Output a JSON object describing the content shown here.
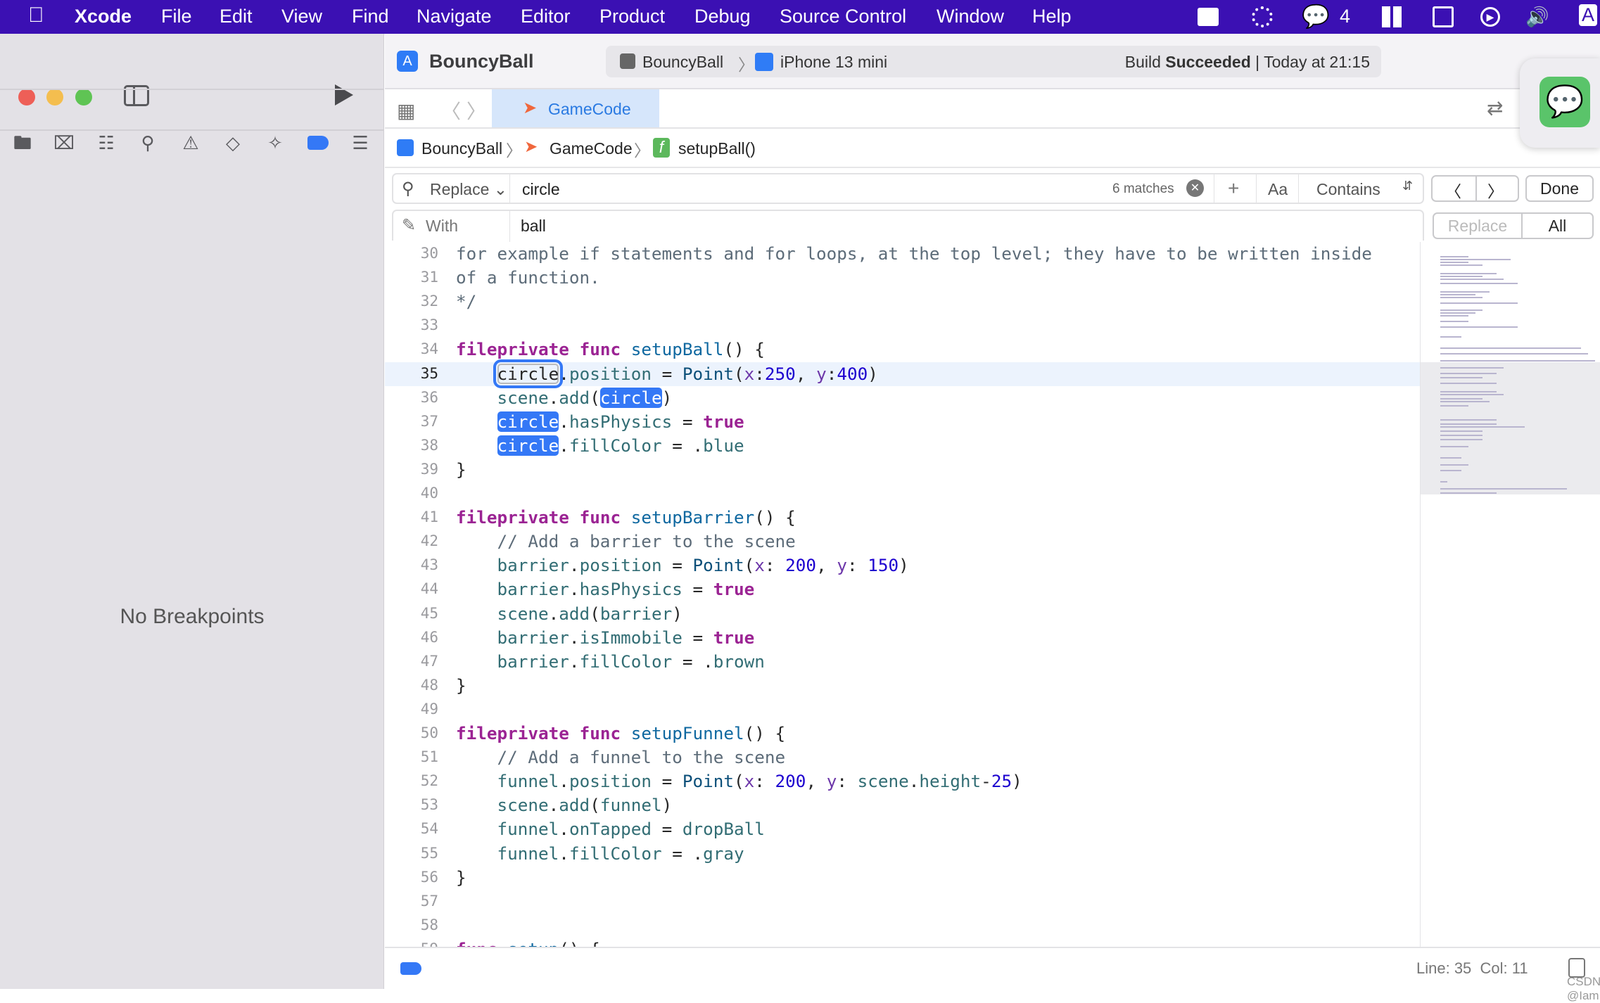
{
  "menubar": {
    "app": "Xcode",
    "items": [
      "File",
      "Edit",
      "View",
      "Find",
      "Navigate",
      "Editor",
      "Product",
      "Debug",
      "Source Control",
      "Window",
      "Help"
    ],
    "wechat_count": "4",
    "input_badge": "A"
  },
  "window": {
    "project": "BouncyBall",
    "scheme": "BouncyBall",
    "device": "iPhone 13 mini",
    "build_prefix": "Build",
    "build_status": "Succeeded",
    "build_time": "Today at 21:15"
  },
  "sidebar": {
    "empty_text": "No Breakpoints"
  },
  "tabs": [
    {
      "label": "GameCode",
      "active": true
    }
  ],
  "breadcrumb": [
    "BouncyBall",
    "GameCode",
    "setupBall()"
  ],
  "find": {
    "mode": "Replace",
    "query": "circle",
    "matches": "6 matches",
    "case_label": "Aa",
    "match_type": "Contains",
    "done": "Done",
    "with_label": "With",
    "replacement": "ball",
    "replace_label": "Replace",
    "all_label": "All"
  },
  "status": {
    "position": "Line: 35  Col: 11",
    "watermark": "CSDN @IamKieran"
  },
  "colors": {
    "accent": "#3478f6",
    "menubar": "#3b10b3",
    "keyword": "#9b2393"
  },
  "editor": {
    "current_line": 35,
    "lines": [
      {
        "n": 30,
        "t": [
          [
            "for example if statements and for loops, at the top level; they have to be written inside",
            "c"
          ]
        ]
      },
      {
        "n": 31,
        "t": [
          [
            "of a function.",
            "c"
          ]
        ]
      },
      {
        "n": 32,
        "t": [
          [
            "*/",
            "c"
          ]
        ]
      },
      {
        "n": 33,
        "t": []
      },
      {
        "n": 34,
        "t": [
          [
            "fileprivate",
            "k"
          ],
          [
            " "
          ],
          [
            "func",
            "k"
          ],
          [
            " "
          ],
          [
            "setupBall",
            "f"
          ],
          [
            "() {"
          ]
        ]
      },
      {
        "n": 35,
        "t": [
          [
            "    "
          ],
          [
            "circle",
            "mc"
          ],
          [
            "."
          ],
          [
            "position",
            "p"
          ],
          [
            " = "
          ],
          [
            "Point",
            "t"
          ],
          [
            "("
          ],
          [
            "x",
            "l"
          ],
          [
            ":"
          ],
          [
            "250",
            "n"
          ],
          [
            ", "
          ],
          [
            "y",
            "l"
          ],
          [
            ":"
          ],
          [
            "400",
            "n"
          ],
          [
            ")"
          ]
        ]
      },
      {
        "n": 36,
        "t": [
          [
            "    "
          ],
          [
            "scene",
            "p"
          ],
          [
            "."
          ],
          [
            "add",
            "p"
          ],
          [
            "("
          ],
          [
            "circle",
            "m"
          ],
          [
            ")"
          ]
        ]
      },
      {
        "n": 37,
        "t": [
          [
            "    "
          ],
          [
            "circle",
            "m"
          ],
          [
            "."
          ],
          [
            "hasPhysics",
            "p"
          ],
          [
            " = "
          ],
          [
            "true",
            "k"
          ]
        ]
      },
      {
        "n": 38,
        "t": [
          [
            "    "
          ],
          [
            "circle",
            "m"
          ],
          [
            "."
          ],
          [
            "fillColor",
            "p"
          ],
          [
            " = ."
          ],
          [
            "blue",
            "p"
          ]
        ]
      },
      {
        "n": 39,
        "t": [
          [
            "}"
          ]
        ]
      },
      {
        "n": 40,
        "t": []
      },
      {
        "n": 41,
        "t": [
          [
            "fileprivate",
            "k"
          ],
          [
            " "
          ],
          [
            "func",
            "k"
          ],
          [
            " "
          ],
          [
            "setupBarrier",
            "f"
          ],
          [
            "() {"
          ]
        ]
      },
      {
        "n": 42,
        "t": [
          [
            "    "
          ],
          [
            "// Add a barrier to the scene",
            "c"
          ]
        ]
      },
      {
        "n": 43,
        "t": [
          [
            "    "
          ],
          [
            "barrier",
            "p"
          ],
          [
            "."
          ],
          [
            "position",
            "p"
          ],
          [
            " = "
          ],
          [
            "Point",
            "t"
          ],
          [
            "("
          ],
          [
            "x",
            "l"
          ],
          [
            ": "
          ],
          [
            "200",
            "n"
          ],
          [
            ", "
          ],
          [
            "y",
            "l"
          ],
          [
            ": "
          ],
          [
            "150",
            "n"
          ],
          [
            ")"
          ]
        ]
      },
      {
        "n": 44,
        "t": [
          [
            "    "
          ],
          [
            "barrier",
            "p"
          ],
          [
            "."
          ],
          [
            "hasPhysics",
            "p"
          ],
          [
            " = "
          ],
          [
            "true",
            "k"
          ]
        ]
      },
      {
        "n": 45,
        "t": [
          [
            "    "
          ],
          [
            "scene",
            "p"
          ],
          [
            "."
          ],
          [
            "add",
            "p"
          ],
          [
            "("
          ],
          [
            "barrier",
            "p"
          ],
          [
            ")"
          ]
        ]
      },
      {
        "n": 46,
        "t": [
          [
            "    "
          ],
          [
            "barrier",
            "p"
          ],
          [
            "."
          ],
          [
            "isImmobile",
            "p"
          ],
          [
            " = "
          ],
          [
            "true",
            "k"
          ]
        ]
      },
      {
        "n": 47,
        "t": [
          [
            "    "
          ],
          [
            "barrier",
            "p"
          ],
          [
            "."
          ],
          [
            "fillColor",
            "p"
          ],
          [
            " = ."
          ],
          [
            "brown",
            "p"
          ]
        ]
      },
      {
        "n": 48,
        "t": [
          [
            "}"
          ]
        ]
      },
      {
        "n": 49,
        "t": []
      },
      {
        "n": 50,
        "t": [
          [
            "fileprivate",
            "k"
          ],
          [
            " "
          ],
          [
            "func",
            "k"
          ],
          [
            " "
          ],
          [
            "setupFunnel",
            "f"
          ],
          [
            "() {"
          ]
        ]
      },
      {
        "n": 51,
        "t": [
          [
            "    "
          ],
          [
            "// Add a funnel to the scene",
            "c"
          ]
        ]
      },
      {
        "n": 52,
        "t": [
          [
            "    "
          ],
          [
            "funnel",
            "p"
          ],
          [
            "."
          ],
          [
            "position",
            "p"
          ],
          [
            " = "
          ],
          [
            "Point",
            "t"
          ],
          [
            "("
          ],
          [
            "x",
            "l"
          ],
          [
            ": "
          ],
          [
            "200",
            "n"
          ],
          [
            ", "
          ],
          [
            "y",
            "l"
          ],
          [
            ": "
          ],
          [
            "scene",
            "p"
          ],
          [
            "."
          ],
          [
            "height",
            "p"
          ],
          [
            "-"
          ],
          [
            "25",
            "n"
          ],
          [
            ")"
          ]
        ]
      },
      {
        "n": 53,
        "t": [
          [
            "    "
          ],
          [
            "scene",
            "p"
          ],
          [
            "."
          ],
          [
            "add",
            "p"
          ],
          [
            "("
          ],
          [
            "funnel",
            "p"
          ],
          [
            ")"
          ]
        ]
      },
      {
        "n": 54,
        "t": [
          [
            "    "
          ],
          [
            "funnel",
            "p"
          ],
          [
            "."
          ],
          [
            "onTapped",
            "p"
          ],
          [
            " = "
          ],
          [
            "dropBall",
            "p"
          ]
        ]
      },
      {
        "n": 55,
        "t": [
          [
            "    "
          ],
          [
            "funnel",
            "p"
          ],
          [
            "."
          ],
          [
            "fillColor",
            "p"
          ],
          [
            " = ."
          ],
          [
            "gray",
            "p"
          ]
        ]
      },
      {
        "n": 56,
        "t": [
          [
            "}"
          ]
        ]
      },
      {
        "n": 57,
        "t": []
      },
      {
        "n": 58,
        "t": []
      },
      {
        "n": 59,
        "t": [
          [
            "func",
            "k"
          ],
          [
            " "
          ],
          [
            "setup",
            "f"
          ],
          [
            "() {"
          ]
        ]
      }
    ]
  }
}
